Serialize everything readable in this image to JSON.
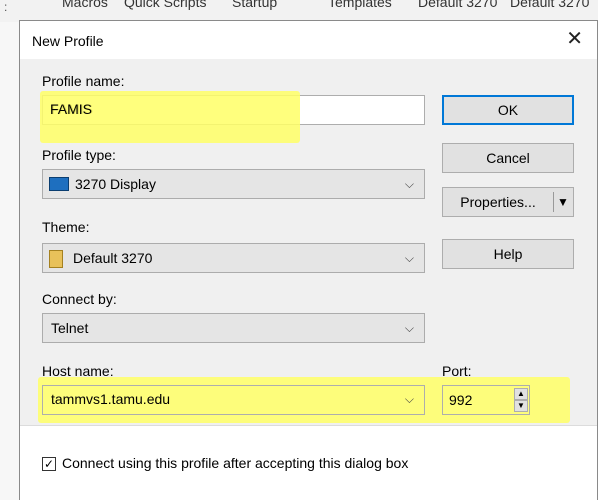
{
  "background_tabs": [
    "Macros",
    "Quick Scripts",
    "Startup",
    "Templates",
    "Default 3270",
    "Default 3270"
  ],
  "dialog": {
    "title": "New Profile",
    "close_glyph": "✕"
  },
  "profile_name": {
    "label": "Profile name:",
    "value": "FAMIS"
  },
  "profile_type": {
    "label": "Profile type:",
    "value": "3270 Display"
  },
  "theme": {
    "label": "Theme:",
    "value": "Default 3270"
  },
  "connect_by": {
    "label": "Connect by:",
    "value": "Telnet"
  },
  "host_name": {
    "label": "Host name:",
    "value": "tammvs1.tamu.edu"
  },
  "port": {
    "label": "Port:",
    "value": "992"
  },
  "buttons": {
    "ok": "OK",
    "cancel": "Cancel",
    "properties": "Properties...",
    "help": "Help"
  },
  "connect_checkbox": {
    "label": "Connect using this profile after accepting this dialog box",
    "checked": true
  },
  "colors": {
    "highlight": "#ffff66",
    "accent": "#0078d7"
  }
}
